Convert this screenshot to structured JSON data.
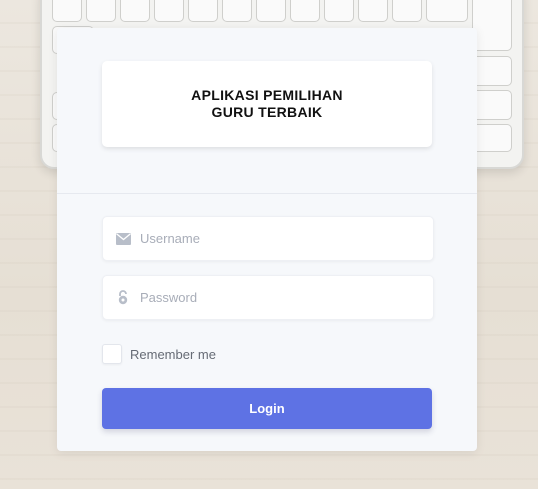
{
  "app": {
    "title_line1": "APLIKASI PEMILIHAN",
    "title_line2": "GURU TERBAIK"
  },
  "form": {
    "username_placeholder": "Username",
    "password_placeholder": "Password",
    "remember_label": "Remember me",
    "login_label": "Login"
  },
  "icons": {
    "username": "envelope-icon",
    "password": "lock-icon"
  },
  "colors": {
    "primary": "#5e72e4",
    "card_bg": "#f6f8fb",
    "placeholder": "#a8adb8"
  }
}
